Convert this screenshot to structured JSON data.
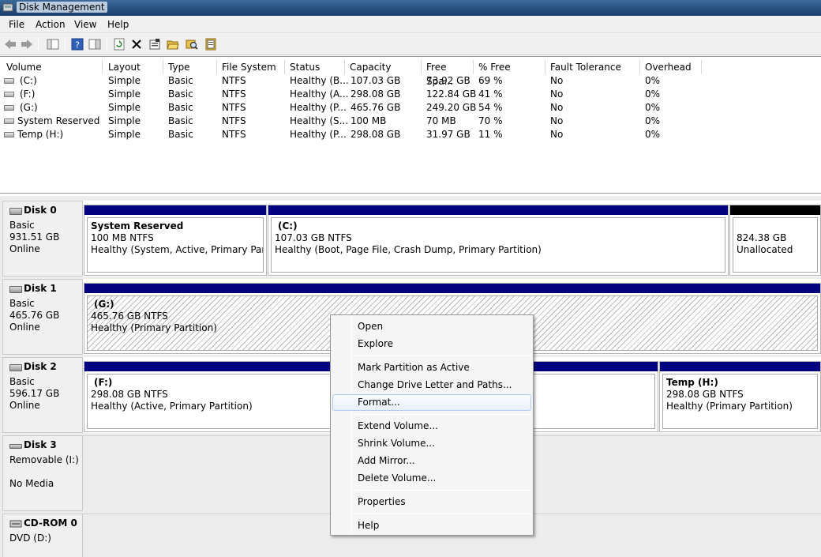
{
  "window": {
    "title": "Disk Management"
  },
  "menu": [
    "File",
    "Action",
    "View",
    "Help"
  ],
  "toolbar": {
    "buttons": [
      "back-arrow-icon",
      "forward-arrow-icon",
      "console-tree-icon",
      "help-icon",
      "show-hide-icon",
      "refresh-icon",
      "delete-icon",
      "properties-icon",
      "open-icon",
      "explore-icon",
      "rescan-icon"
    ]
  },
  "volume_list": {
    "columns": [
      "Volume",
      "Layout",
      "Type",
      "File System",
      "Status",
      "Capacity",
      "Free Spa...",
      "% Free",
      "Fault Tolerance",
      "Overhead"
    ],
    "rows": [
      [
        "(C:)",
        "Simple",
        "Basic",
        "NTFS",
        "Healthy (B...",
        "107.03 GB",
        "73.92 GB",
        "69 %",
        "No",
        "0%"
      ],
      [
        "(F:)",
        "Simple",
        "Basic",
        "NTFS",
        "Healthy (A...",
        "298.08 GB",
        "122.84 GB",
        "41 %",
        "No",
        "0%"
      ],
      [
        "(G:)",
        "Simple",
        "Basic",
        "NTFS",
        "Healthy (P...",
        "465.76 GB",
        "249.20 GB",
        "54 %",
        "No",
        "0%"
      ],
      [
        "System Reserved",
        "Simple",
        "Basic",
        "NTFS",
        "Healthy (S...",
        "100 MB",
        "70 MB",
        "70 %",
        "No",
        "0%"
      ],
      [
        "Temp (H:)",
        "Simple",
        "Basic",
        "NTFS",
        "Healthy (P...",
        "298.08 GB",
        "31.97 GB",
        "11 %",
        "No",
        "0%"
      ]
    ]
  },
  "disks": [
    {
      "name": "Disk 0",
      "type": "Basic",
      "size": "931.51 GB",
      "state": "Online",
      "partitions": [
        {
          "title": "System Reserved",
          "size": "100 MB NTFS",
          "status": "Healthy (System, Active, Primary Partitior"
        },
        {
          "title": "(C:)",
          "size": "107.03 GB NTFS",
          "status": "Healthy (Boot, Page File, Crash Dump, Primary Partition)"
        },
        {
          "title": "",
          "size": "824.38 GB",
          "status": "Unallocated"
        }
      ]
    },
    {
      "name": "Disk 1",
      "type": "Basic",
      "size": "465.76 GB",
      "state": "Online",
      "partitions": [
        {
          "title": "(G:)",
          "size": "465.76 GB NTFS",
          "status": "Healthy (Primary Partition)"
        }
      ]
    },
    {
      "name": "Disk 2",
      "type": "Basic",
      "size": "596.17 GB",
      "state": "Online",
      "partitions": [
        {
          "title": "(F:)",
          "size": "298.08 GB NTFS",
          "status": "Healthy (Active, Primary Partition)"
        },
        {
          "title": "Temp  (H:)",
          "size": "298.08 GB NTFS",
          "status": "Healthy (Primary Partition)"
        }
      ]
    },
    {
      "name": "Disk 3",
      "type": "Removable (I:)",
      "size": "",
      "state": "No Media",
      "partitions": []
    },
    {
      "name": "CD-ROM 0",
      "type": "DVD (D:)",
      "size": "",
      "state": "",
      "partitions": []
    }
  ],
  "context_menu": {
    "items": [
      "Open",
      "Explore",
      "Mark Partition as Active",
      "Change Drive Letter and Paths...",
      "Format...",
      "Extend Volume...",
      "Shrink Volume...",
      "Add Mirror...",
      "Delete Volume...",
      "Properties",
      "Help"
    ],
    "highlighted": "Format..."
  },
  "colors": {
    "primary_bar": "#030380",
    "unallocated_bar": "#000000",
    "menu_highlight": "#aeccf1"
  }
}
